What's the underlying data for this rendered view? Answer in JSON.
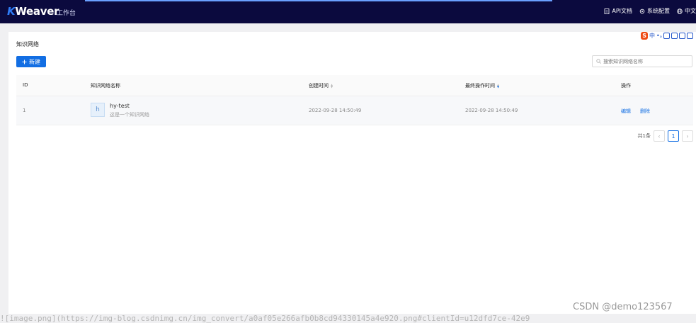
{
  "header": {
    "logo_k": "K",
    "logo_rest": "Weaver",
    "workbench": "工作台",
    "api_docs": "API文档",
    "system_config": "系统配置",
    "language": "中文"
  },
  "ime": {
    "label_s": "S",
    "label_zh": "中",
    "label_punct": "•ₒ"
  },
  "page": {
    "title": "知识网络",
    "add_button": "新建",
    "search_placeholder": "搜索知识网络名称"
  },
  "table": {
    "columns": {
      "id": "ID",
      "name": "知识网络名称",
      "created": "创建时间",
      "updated": "最终操作时间",
      "actions": "操作"
    },
    "rows": [
      {
        "id": "1",
        "avatar": "h",
        "name": "hy-test",
        "description": "这是一个知识网络",
        "created": "2022-09-28 14:50:49",
        "updated": "2022-09-28 14:50:49",
        "edit": "编辑",
        "delete": "删除"
      }
    ]
  },
  "pagination": {
    "total": "共1条",
    "current": "1",
    "prev": "‹",
    "next": "›"
  },
  "overlay": {
    "watermark": "CSDN @demo123567",
    "md_link": "![image.png](https://img-blog.csdnimg.cn/img_convert/a0af05e266afb0b8cd94330145a4e920.png#clientId=u12dfd7ce-42e9"
  },
  "colors": {
    "topbar": "#0b0a3e",
    "accent": "#126ee3"
  }
}
